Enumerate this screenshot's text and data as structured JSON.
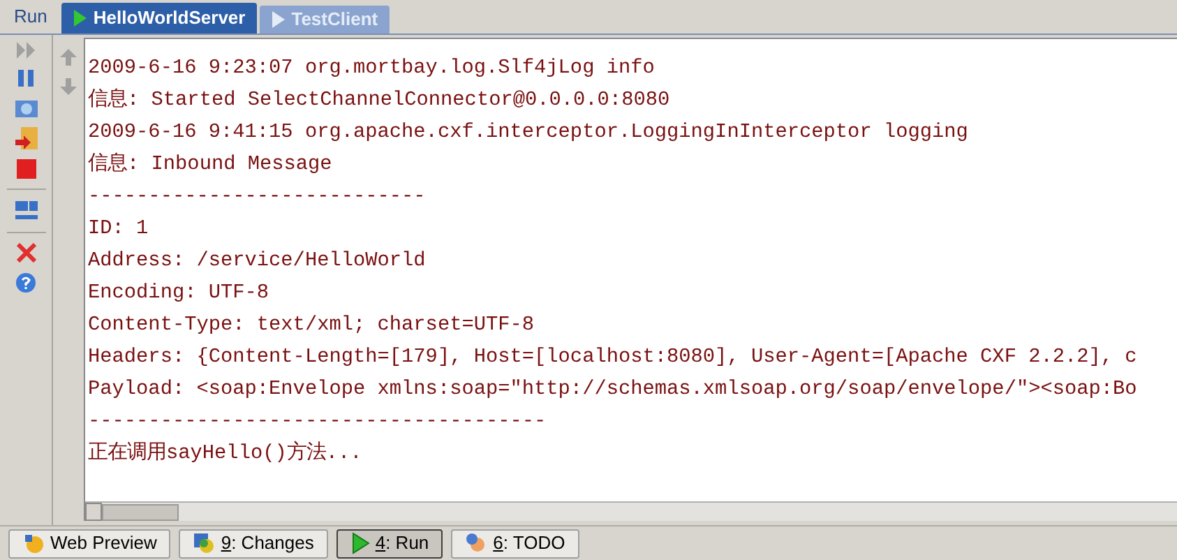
{
  "panel": {
    "title": "Run"
  },
  "tabs": [
    {
      "label": "HelloWorldServer",
      "selected": true
    },
    {
      "label": "TestClient",
      "selected": false
    }
  ],
  "console": {
    "lines": [
      "2009-6-16 9:23:07 org.mortbay.log.Slf4jLog info",
      "信息: Started SelectChannelConnector@0.0.0.0:8080",
      "2009-6-16 9:41:15 org.apache.cxf.interceptor.LoggingInInterceptor logging",
      "信息: Inbound Message",
      "----------------------------",
      "ID: 1",
      "Address: /service/HelloWorld",
      "Encoding: UTF-8",
      "Content-Type: text/xml; charset=UTF-8",
      "Headers: {Content-Length=[179], Host=[localhost:8080], User-Agent=[Apache CXF 2.2.2], c",
      "Payload: <soap:Envelope xmlns:soap=\"http://schemas.xmlsoap.org/soap/envelope/\"><soap:Bo",
      "--------------------------------------",
      "正在调用sayHello()方法..."
    ]
  },
  "tool_buttons": [
    {
      "kind": "web",
      "label": "Web Preview",
      "selected": false
    },
    {
      "kind": "changes",
      "key": "9",
      "label": ": Changes",
      "selected": false
    },
    {
      "kind": "run",
      "key": "4",
      "label": ": Run",
      "selected": true
    },
    {
      "kind": "todo",
      "key": "6",
      "label": ": TODO",
      "selected": false
    }
  ]
}
